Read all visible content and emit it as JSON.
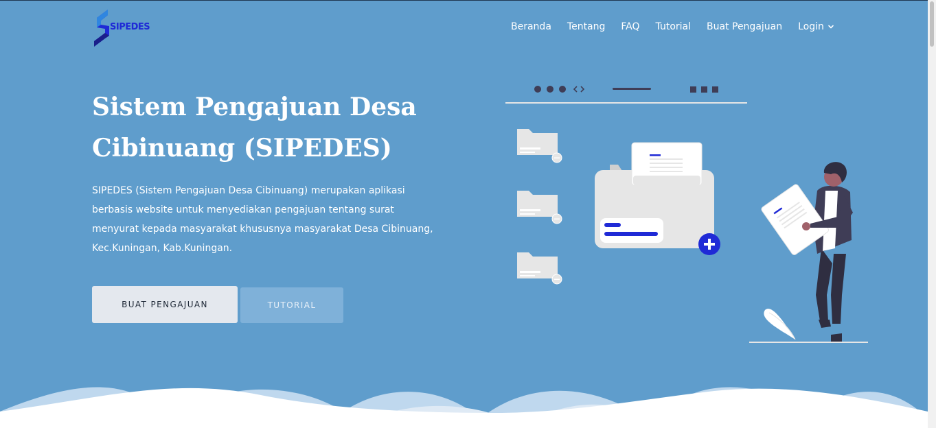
{
  "brand": {
    "name": "SIPEDES",
    "logo_color": "#1f2ad6"
  },
  "nav": {
    "items": [
      "Beranda",
      "Tentang",
      "FAQ",
      "Tutorial",
      "Buat Pengajuan"
    ],
    "login_label": "Login",
    "login_icon": "chevron-down-icon"
  },
  "hero": {
    "title_line1": "Sistem Pengajuan Desa",
    "title_line2": "Cibinuang (SIPEDES)",
    "description": "SIPEDES (Sistem Pengajuan Desa Cibinuang) merupakan aplikasi berbasis website untuk menyediakan pengajuan tentang surat menyurat kepada masyarakat khususnya masyarakat Desa Cibinuang, Kec.Kuningan, Kab.Kuningan.",
    "primary_button": "BUAT PENGAJUAN",
    "secondary_button": "TUTORIAL"
  },
  "colors": {
    "background": "#5f9dcc",
    "accent": "#1f2ad6",
    "text": "#ffffff"
  }
}
